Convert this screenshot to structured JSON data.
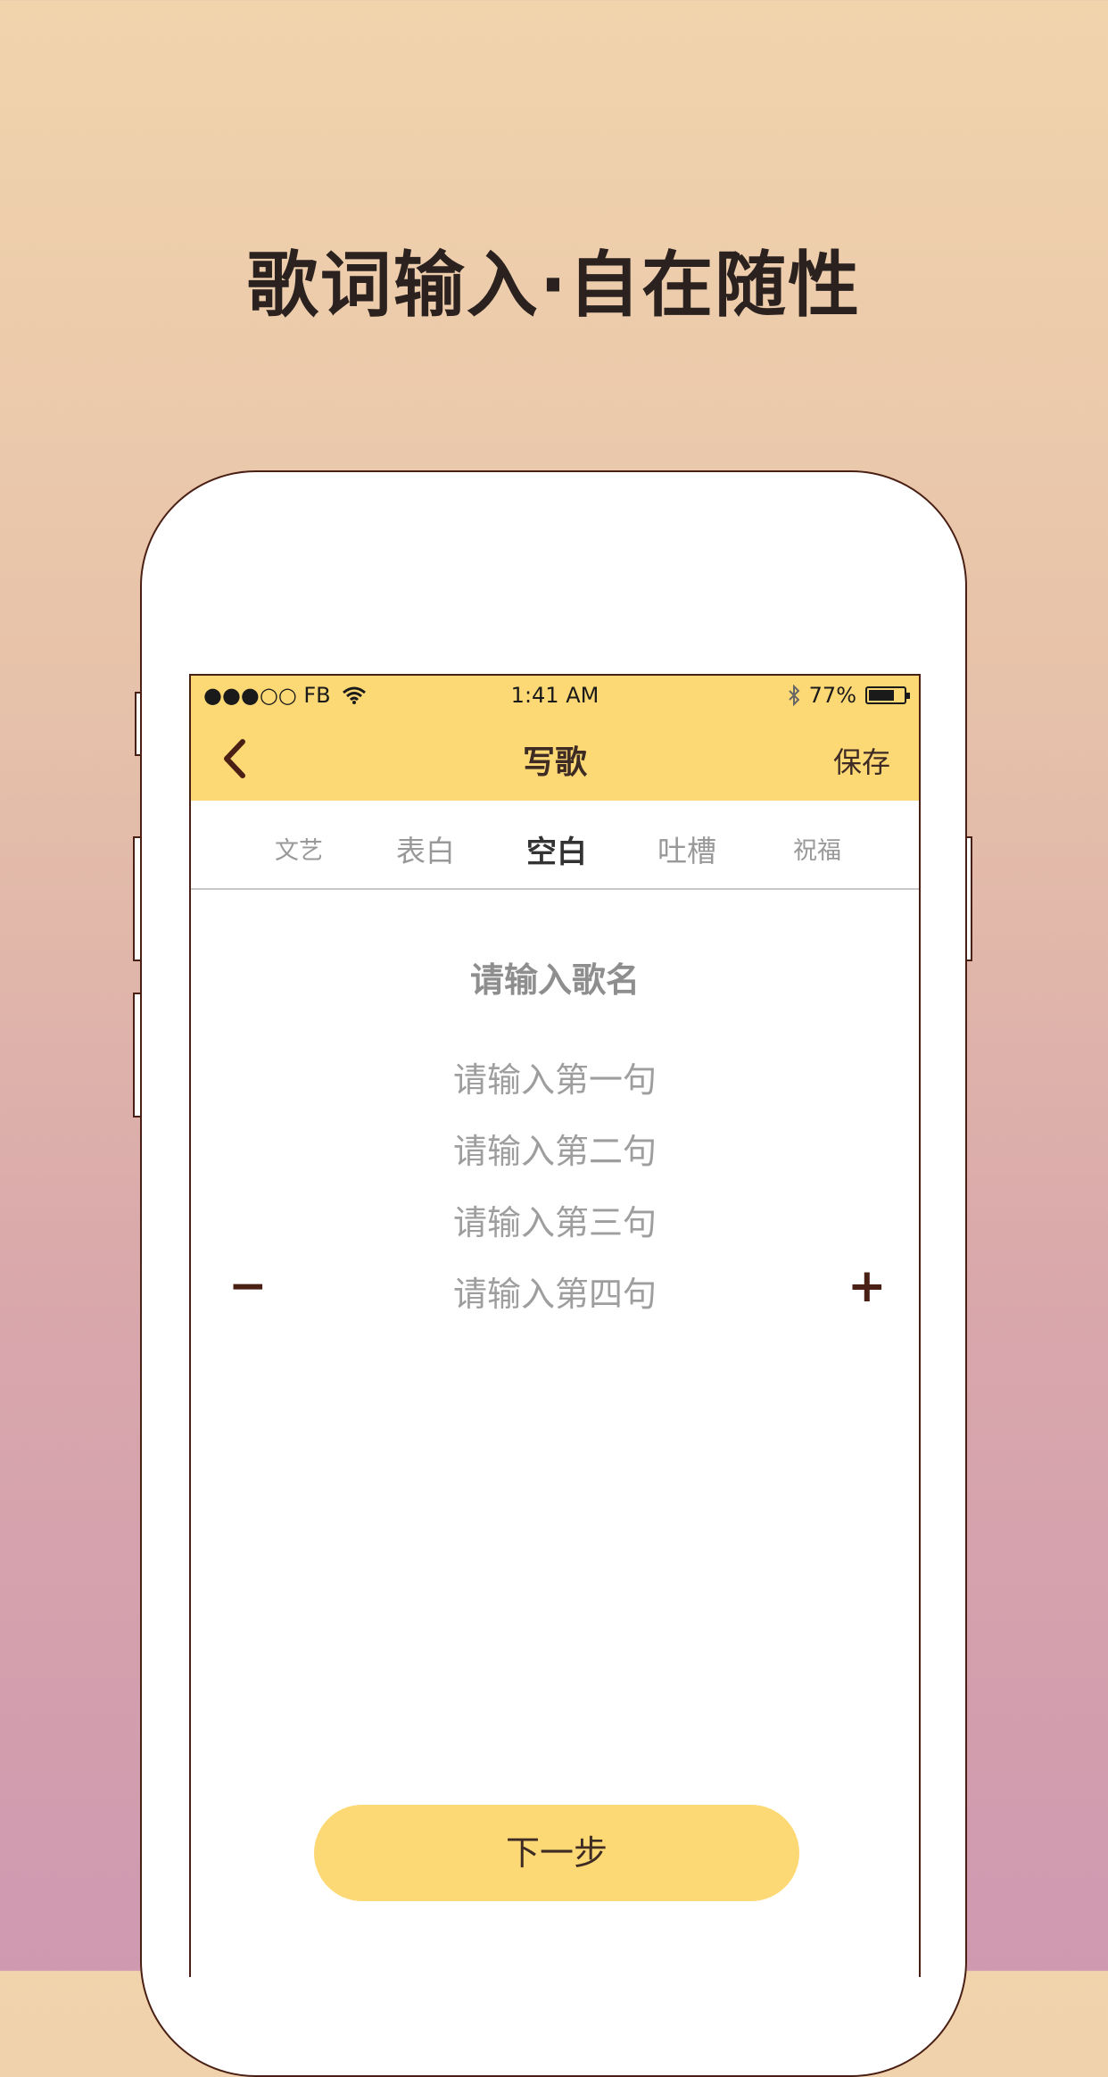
{
  "headline": "歌词输入·自在随性",
  "status_bar": {
    "carrier": "●●●○○ FB",
    "wifi_icon": "wifi-icon",
    "time": "1:41 AM",
    "bluetooth_icon": "bluetooth-icon",
    "battery_text": "77%",
    "battery_level": 0.77
  },
  "navbar": {
    "back_icon": "chevron-left-icon",
    "title": "写歌",
    "save_label": "保存"
  },
  "tabs": [
    {
      "label": "文艺",
      "active": false
    },
    {
      "label": "表白",
      "active": false
    },
    {
      "label": "空白",
      "active": true
    },
    {
      "label": "吐槽",
      "active": false
    },
    {
      "label": "祝福",
      "active": false
    }
  ],
  "song_name_placeholder": "请输入歌名",
  "lyric_lines": [
    "请输入第一句",
    "请输入第二句",
    "请输入第三句",
    "请输入第四句"
  ],
  "remove_line_symbol": "−",
  "add_line_symbol": "+",
  "next_button_label": "下一步",
  "colors": {
    "accent": "#fdd976",
    "dark_brown": "#4a1f14",
    "placeholder_gray": "#9e9e9e"
  }
}
